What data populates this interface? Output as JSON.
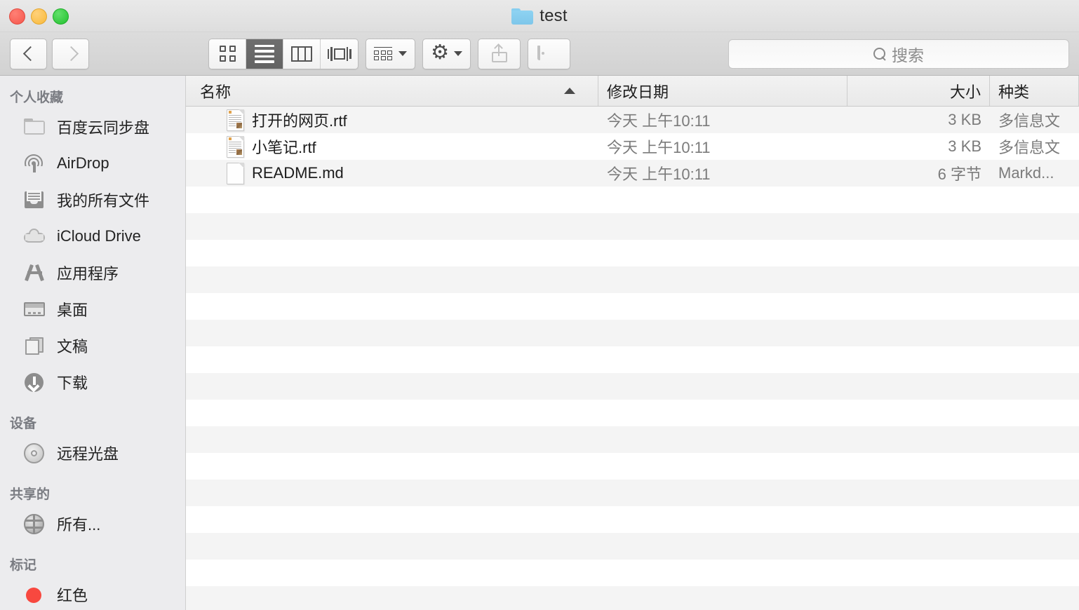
{
  "window": {
    "title": "test",
    "folder_icon": "folder-icon",
    "traffic_lights": [
      "close-button",
      "minimize-button",
      "zoom-button"
    ]
  },
  "toolbar": {
    "back_label": "back-chevron-icon",
    "forward_label": "forward-chevron-icon",
    "view_modes": [
      {
        "name": "icon-view",
        "icon": "grid-icon",
        "active": false
      },
      {
        "name": "list-view",
        "icon": "list-icon",
        "active": true
      },
      {
        "name": "column-view",
        "icon": "columns-icon",
        "active": false
      },
      {
        "name": "coverflow-view",
        "icon": "coverflow-icon",
        "active": false
      }
    ],
    "arrange_icon": "arrange-icon",
    "action_icon": "gear-icon",
    "share_icon": "share-icon",
    "tag_icon": "tag-icon"
  },
  "search": {
    "placeholder": "搜索",
    "value": "",
    "icon": "search-icon"
  },
  "sidebar": {
    "groups": [
      {
        "title": "个人收藏",
        "items": [
          {
            "label": "百度云同步盘",
            "icon": "folder-icon"
          },
          {
            "label": "AirDrop",
            "icon": "airdrop-icon"
          },
          {
            "label": "我的所有文件",
            "icon": "all-my-files-icon"
          },
          {
            "label": "iCloud Drive",
            "icon": "icloud-icon"
          },
          {
            "label": "应用程序",
            "icon": "applications-icon"
          },
          {
            "label": "桌面",
            "icon": "desktop-icon"
          },
          {
            "label": "文稿",
            "icon": "documents-icon"
          },
          {
            "label": "下载",
            "icon": "downloads-icon"
          }
        ]
      },
      {
        "title": "设备",
        "items": [
          {
            "label": "远程光盘",
            "icon": "disc-icon"
          }
        ]
      },
      {
        "title": "共享的",
        "items": [
          {
            "label": "所有...",
            "icon": "network-icon"
          }
        ]
      },
      {
        "title": "标记",
        "items": [
          {
            "label": "红色",
            "icon": "red-tag-dot-icon"
          }
        ]
      }
    ]
  },
  "file_list": {
    "columns": [
      {
        "key": "name",
        "label": "名称",
        "sorted": true,
        "sort_direction": "ascending"
      },
      {
        "key": "date",
        "label": "修改日期"
      },
      {
        "key": "size",
        "label": "大小"
      },
      {
        "key": "kind",
        "label": "种类"
      }
    ],
    "rows": [
      {
        "name": "打开的网页.rtf",
        "date": "今天 上午10:11",
        "size": "3 KB",
        "kind": "多信息文",
        "icon": "rtf-document-icon"
      },
      {
        "name": "小笔记.rtf",
        "date": "今天 上午10:11",
        "size": "3 KB",
        "kind": "多信息文",
        "icon": "rtf-document-icon"
      },
      {
        "name": "README.md",
        "date": "今天 上午10:11",
        "size": "6 字节",
        "kind": "Markd...",
        "icon": "plain-document-icon"
      }
    ]
  },
  "colors": {
    "close": "#f5564b",
    "minimize": "#f8b93a",
    "zoom": "#23c02f",
    "folder_blue": "#7ec6ea",
    "red_tag": "#f8483f",
    "row_stripe": "#f4f4f4",
    "sidebar_bg": "#ececee"
  }
}
